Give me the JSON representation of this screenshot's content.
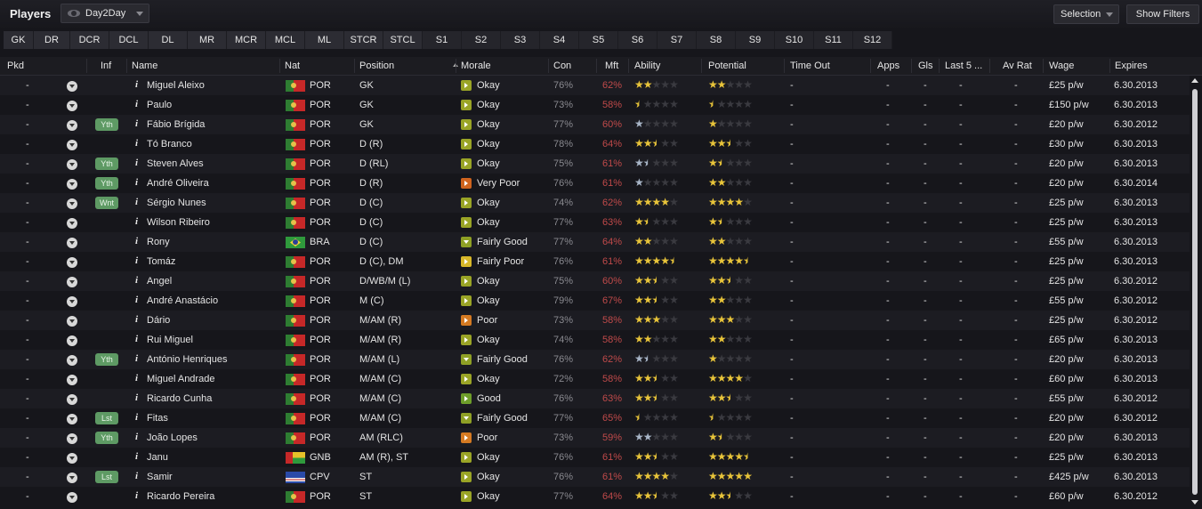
{
  "panel": {
    "title": "Players",
    "view": "Day2Day",
    "selection_label": "Selection",
    "show_filters_label": "Show Filters"
  },
  "filters": [
    "GK",
    "DR",
    "DCR",
    "DCL",
    "DL",
    "MR",
    "MCR",
    "MCL",
    "ML",
    "STCR",
    "STCL",
    "S1",
    "S2",
    "S3",
    "S4",
    "S5",
    "S6",
    "S7",
    "S8",
    "S9",
    "S10",
    "S11",
    "S12"
  ],
  "columns": [
    "Pkd",
    "Inf",
    "Name",
    "Nat",
    "Position",
    "Morale",
    "Con",
    "Mft",
    "Ability",
    "Potential",
    "Time Out",
    "Apps",
    "Gls",
    "Last 5 ...",
    "Av Rat",
    "Wage",
    "Expires"
  ],
  "empty": "-",
  "info_glyph": "i",
  "colors": {
    "morale_okay": "#9aa426",
    "morale_very_poor": "#d0641e",
    "mft_red": "#c04a4a",
    "badge_green": "#5e9a64",
    "star_gold": "#e8c43a"
  },
  "icons": {
    "dropdown": "chevron-down-icon",
    "info": "info-icon",
    "sort": "sort-ascending-icon",
    "eye": "eye-icon"
  },
  "rows": [
    {
      "pkd": "-",
      "inf": "",
      "name": "Miguel Aleixo",
      "nat": "POR",
      "position": "GK",
      "morale": "Okay",
      "morale_icon": "okay",
      "con": "76%",
      "mft": "62%",
      "ability": 2,
      "potential": 2,
      "time_out": "-",
      "apps": "-",
      "gls": "-",
      "last5": "-",
      "av_rat": "-",
      "wage": "£25 p/w",
      "expires": "6.30.2013"
    },
    {
      "pkd": "-",
      "inf": "",
      "name": "Paulo",
      "nat": "POR",
      "position": "GK",
      "morale": "Okay",
      "morale_icon": "okay",
      "con": "73%",
      "mft": "58%",
      "ability": 0.5,
      "potential": 0.5,
      "time_out": "-",
      "apps": "-",
      "gls": "-",
      "last5": "-",
      "av_rat": "-",
      "wage": "£150 p/w",
      "expires": "6.30.2013"
    },
    {
      "pkd": "-",
      "inf": "Yth",
      "name": "Fábio Brígida",
      "nat": "POR",
      "position": "GK",
      "morale": "Okay",
      "morale_icon": "okay",
      "con": "77%",
      "mft": "60%",
      "ability": 1,
      "ability_silver": true,
      "potential": 1,
      "time_out": "-",
      "apps": "-",
      "gls": "-",
      "last5": "-",
      "av_rat": "-",
      "wage": "£20 p/w",
      "expires": "6.30.2012"
    },
    {
      "pkd": "-",
      "inf": "",
      "name": "Tó Branco",
      "nat": "POR",
      "position": "D (R)",
      "morale": "Okay",
      "morale_icon": "okay",
      "con": "78%",
      "mft": "64%",
      "ability": 2.5,
      "potential": 2.5,
      "time_out": "-",
      "apps": "-",
      "gls": "-",
      "last5": "-",
      "av_rat": "-",
      "wage": "£30 p/w",
      "expires": "6.30.2013"
    },
    {
      "pkd": "-",
      "inf": "Yth",
      "name": "Steven Alves",
      "nat": "POR",
      "position": "D (RL)",
      "morale": "Okay",
      "morale_icon": "okay",
      "con": "75%",
      "mft": "61%",
      "ability": 1.5,
      "ability_silver": true,
      "potential": 1.5,
      "time_out": "-",
      "apps": "-",
      "gls": "-",
      "last5": "-",
      "av_rat": "-",
      "wage": "£20 p/w",
      "expires": "6.30.2013"
    },
    {
      "pkd": "-",
      "inf": "Yth",
      "name": "André Oliveira",
      "nat": "POR",
      "position": "D (R)",
      "morale": "Very Poor",
      "morale_icon": "vpoor",
      "con": "76%",
      "mft": "61%",
      "ability": 1,
      "ability_silver": true,
      "potential": 2,
      "time_out": "-",
      "apps": "-",
      "gls": "-",
      "last5": "-",
      "av_rat": "-",
      "wage": "£20 p/w",
      "expires": "6.30.2014"
    },
    {
      "pkd": "-",
      "inf": "Wnt",
      "name": "Sérgio Nunes",
      "nat": "POR",
      "position": "D (C)",
      "morale": "Okay",
      "morale_icon": "okay",
      "con": "74%",
      "mft": "62%",
      "ability": 4,
      "potential": 4,
      "time_out": "-",
      "apps": "-",
      "gls": "-",
      "last5": "-",
      "av_rat": "-",
      "wage": "£25 p/w",
      "expires": "6.30.2013"
    },
    {
      "pkd": "-",
      "inf": "",
      "name": "Wilson Ribeiro",
      "nat": "POR",
      "position": "D (C)",
      "morale": "Okay",
      "morale_icon": "okay",
      "con": "77%",
      "mft": "63%",
      "ability": 1.5,
      "potential": 1.5,
      "time_out": "-",
      "apps": "-",
      "gls": "-",
      "last5": "-",
      "av_rat": "-",
      "wage": "£25 p/w",
      "expires": "6.30.2013"
    },
    {
      "pkd": "-",
      "inf": "",
      "name": "Rony",
      "nat": "BRA",
      "position": "D (C)",
      "morale": "Fairly Good",
      "morale_icon": "fgood",
      "con": "77%",
      "mft": "64%",
      "ability": 2,
      "potential": 2,
      "time_out": "-",
      "apps": "-",
      "gls": "-",
      "last5": "-",
      "av_rat": "-",
      "wage": "£55 p/w",
      "expires": "6.30.2013"
    },
    {
      "pkd": "-",
      "inf": "",
      "name": "Tomáz",
      "nat": "POR",
      "position": "D (C), DM",
      "morale": "Fairly Poor",
      "morale_icon": "fpoor",
      "con": "76%",
      "mft": "61%",
      "ability": 4.5,
      "potential": 4.5,
      "time_out": "-",
      "apps": "-",
      "gls": "-",
      "last5": "-",
      "av_rat": "-",
      "wage": "£25 p/w",
      "expires": "6.30.2013"
    },
    {
      "pkd": "-",
      "inf": "",
      "name": "Angel",
      "nat": "POR",
      "position": "D/WB/M (L)",
      "morale": "Okay",
      "morale_icon": "okay",
      "con": "75%",
      "mft": "60%",
      "ability": 2.5,
      "potential": 2.5,
      "time_out": "-",
      "apps": "-",
      "gls": "-",
      "last5": "-",
      "av_rat": "-",
      "wage": "£25 p/w",
      "expires": "6.30.2012"
    },
    {
      "pkd": "-",
      "inf": "",
      "name": "André Anastácio",
      "nat": "POR",
      "position": "M (C)",
      "morale": "Okay",
      "morale_icon": "okay",
      "con": "79%",
      "mft": "67%",
      "ability": 2.5,
      "potential": 2,
      "time_out": "-",
      "apps": "-",
      "gls": "-",
      "last5": "-",
      "av_rat": "-",
      "wage": "£55 p/w",
      "expires": "6.30.2012"
    },
    {
      "pkd": "-",
      "inf": "",
      "name": "Dário",
      "nat": "POR",
      "position": "M/AM (R)",
      "morale": "Poor",
      "morale_icon": "poor",
      "con": "73%",
      "mft": "58%",
      "ability": 3,
      "potential": 3,
      "time_out": "-",
      "apps": "-",
      "gls": "-",
      "last5": "-",
      "av_rat": "-",
      "wage": "£25 p/w",
      "expires": "6.30.2012"
    },
    {
      "pkd": "-",
      "inf": "",
      "name": "Rui Miguel",
      "nat": "POR",
      "position": "M/AM (R)",
      "morale": "Okay",
      "morale_icon": "okay",
      "con": "74%",
      "mft": "58%",
      "ability": 2,
      "potential": 2,
      "time_out": "-",
      "apps": "-",
      "gls": "-",
      "last5": "-",
      "av_rat": "-",
      "wage": "£65 p/w",
      "expires": "6.30.2013"
    },
    {
      "pkd": "-",
      "inf": "Yth",
      "name": "António Henriques",
      "nat": "POR",
      "position": "M/AM (L)",
      "morale": "Fairly Good",
      "morale_icon": "fgood",
      "con": "76%",
      "mft": "62%",
      "ability": 1.5,
      "ability_silver": true,
      "potential": 1,
      "time_out": "-",
      "apps": "-",
      "gls": "-",
      "last5": "-",
      "av_rat": "-",
      "wage": "£20 p/w",
      "expires": "6.30.2013"
    },
    {
      "pkd": "-",
      "inf": "",
      "name": "Miguel Andrade",
      "nat": "POR",
      "position": "M/AM (C)",
      "morale": "Okay",
      "morale_icon": "okay",
      "con": "72%",
      "mft": "58%",
      "ability": 2.5,
      "potential": 4,
      "time_out": "-",
      "apps": "-",
      "gls": "-",
      "last5": "-",
      "av_rat": "-",
      "wage": "£60 p/w",
      "expires": "6.30.2013"
    },
    {
      "pkd": "-",
      "inf": "",
      "name": "Ricardo Cunha",
      "nat": "POR",
      "position": "M/AM (C)",
      "morale": "Good",
      "morale_icon": "good",
      "con": "76%",
      "mft": "63%",
      "ability": 2.5,
      "potential": 2.5,
      "time_out": "-",
      "apps": "-",
      "gls": "-",
      "last5": "-",
      "av_rat": "-",
      "wage": "£55 p/w",
      "expires": "6.30.2012"
    },
    {
      "pkd": "-",
      "inf": "Lst",
      "name": "Fitas",
      "nat": "POR",
      "position": "M/AM (C)",
      "morale": "Fairly Good",
      "morale_icon": "fgood",
      "con": "77%",
      "mft": "65%",
      "ability": 0.5,
      "potential": 0.5,
      "time_out": "-",
      "apps": "-",
      "gls": "-",
      "last5": "-",
      "av_rat": "-",
      "wage": "£20 p/w",
      "expires": "6.30.2012"
    },
    {
      "pkd": "-",
      "inf": "Yth",
      "name": "João Lopes",
      "nat": "POR",
      "position": "AM (RLC)",
      "morale": "Poor",
      "morale_icon": "poor",
      "con": "73%",
      "mft": "59%",
      "ability": 2,
      "ability_silver": true,
      "potential": 1.5,
      "time_out": "-",
      "apps": "-",
      "gls": "-",
      "last5": "-",
      "av_rat": "-",
      "wage": "£20 p/w",
      "expires": "6.30.2013"
    },
    {
      "pkd": "-",
      "inf": "",
      "name": "Janu",
      "nat": "GNB",
      "position": "AM (R), ST",
      "morale": "Okay",
      "morale_icon": "okay",
      "con": "76%",
      "mft": "61%",
      "ability": 2.5,
      "potential": 4.5,
      "time_out": "-",
      "apps": "-",
      "gls": "-",
      "last5": "-",
      "av_rat": "-",
      "wage": "£25 p/w",
      "expires": "6.30.2013"
    },
    {
      "pkd": "-",
      "inf": "Lst",
      "name": "Samir",
      "nat": "CPV",
      "position": "ST",
      "morale": "Okay",
      "morale_icon": "okay",
      "con": "76%",
      "mft": "61%",
      "ability": 4,
      "potential": 5,
      "time_out": "-",
      "apps": "-",
      "gls": "-",
      "last5": "-",
      "av_rat": "-",
      "wage": "£425 p/w",
      "expires": "6.30.2013"
    },
    {
      "pkd": "-",
      "inf": "",
      "name": "Ricardo Pereira",
      "nat": "POR",
      "position": "ST",
      "morale": "Okay",
      "morale_icon": "okay",
      "con": "77%",
      "mft": "64%",
      "ability": 2.5,
      "potential": 2.5,
      "time_out": "-",
      "apps": "-",
      "gls": "-",
      "last5": "-",
      "av_rat": "-",
      "wage": "£60 p/w",
      "expires": "6.30.2012"
    }
  ]
}
